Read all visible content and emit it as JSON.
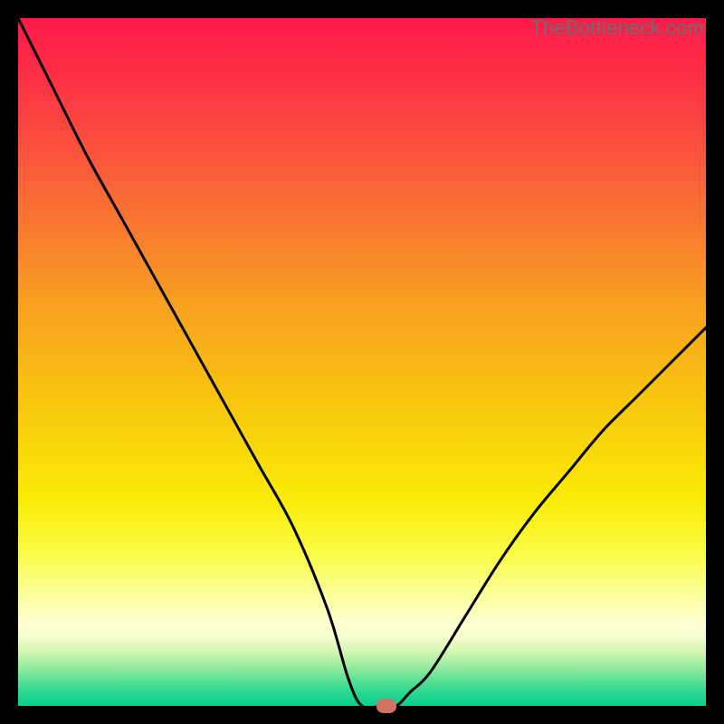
{
  "watermark": "TheBottleneck.com",
  "chart_data": {
    "type": "line",
    "title": "",
    "xlabel": "",
    "ylabel": "",
    "xlim": [
      0,
      100
    ],
    "ylim": [
      0,
      100
    ],
    "x": [
      0,
      5,
      10,
      15,
      20,
      25,
      30,
      35,
      40,
      45,
      48,
      50,
      53,
      55,
      57,
      60,
      65,
      70,
      75,
      80,
      85,
      90,
      95,
      100
    ],
    "y": [
      100,
      90,
      80,
      71,
      62,
      53,
      44,
      35,
      26,
      14,
      4,
      0,
      0,
      0,
      2,
      5,
      13,
      21,
      28,
      34,
      40,
      45,
      50,
      55
    ],
    "marker": {
      "x": 53.5,
      "y": 0
    },
    "gradient_stops": [
      {
        "pos": 0,
        "color": "#fd1a4a"
      },
      {
        "pos": 70,
        "color": "#faeb06"
      },
      {
        "pos": 100,
        "color": "#07d08e"
      }
    ]
  }
}
